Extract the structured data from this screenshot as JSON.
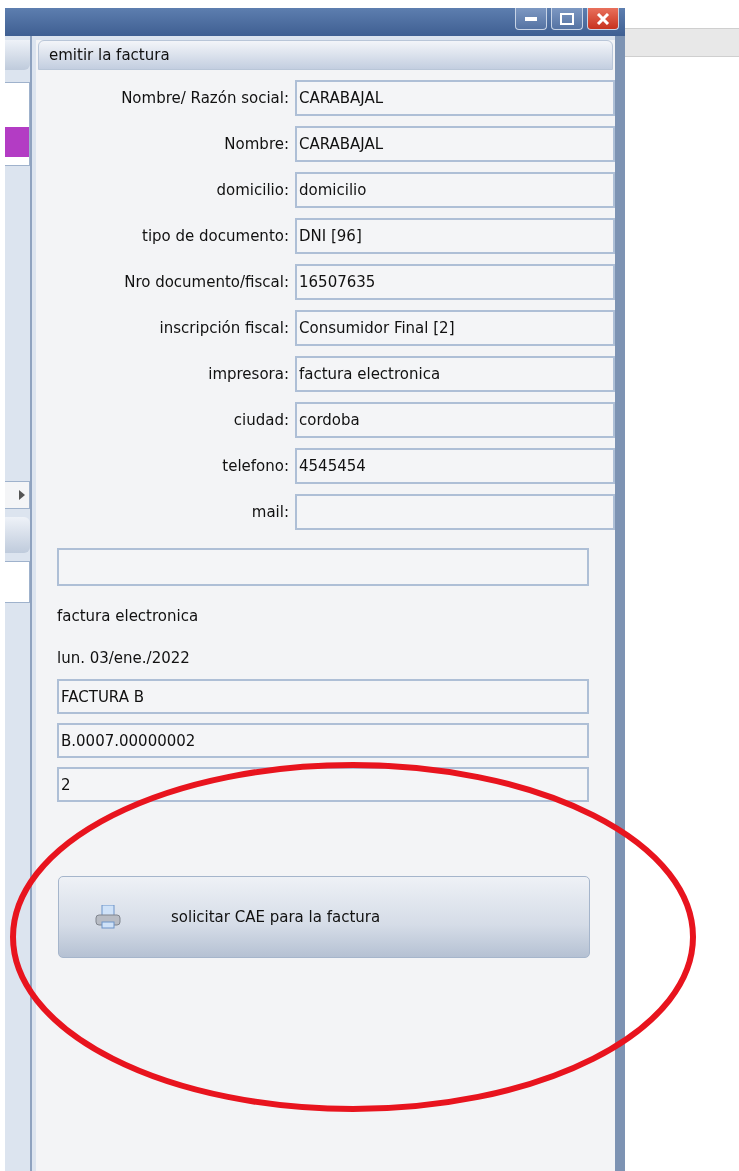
{
  "panel": {
    "title": "emitir la factura"
  },
  "fields": [
    {
      "label": "Nombre/ Razón social:",
      "value": "CARABAJAL"
    },
    {
      "label": "Nombre:",
      "value": "CARABAJAL"
    },
    {
      "label": "domicilio:",
      "value": "domicilio"
    },
    {
      "label": "tipo de documento:",
      "value": "DNI [96]"
    },
    {
      "label": "Nro documento/fiscal:",
      "value": "16507635"
    },
    {
      "label": "inscripción fiscal:",
      "value": "Consumidor Final [2]"
    },
    {
      "label": "impresora:",
      "value": "factura electronica"
    },
    {
      "label": "ciudad:",
      "value": "cordoba"
    },
    {
      "label": "telefono:",
      "value": "4545454"
    },
    {
      "label": "mail:"
    }
  ],
  "details": [
    {
      "kind": "field"
    },
    {
      "kind": "text",
      "text": "factura electronica"
    },
    {
      "kind": "text",
      "text": "lun. 03/ene./2022"
    },
    {
      "kind": "field",
      "value": "FACTURA B"
    },
    {
      "kind": "field",
      "value": "B.0007.00000002"
    },
    {
      "kind": "field",
      "value": "2"
    }
  ],
  "action_button": {
    "label": "solicitar CAE para la factura"
  },
  "annotation": {
    "kind": "ellipse"
  }
}
